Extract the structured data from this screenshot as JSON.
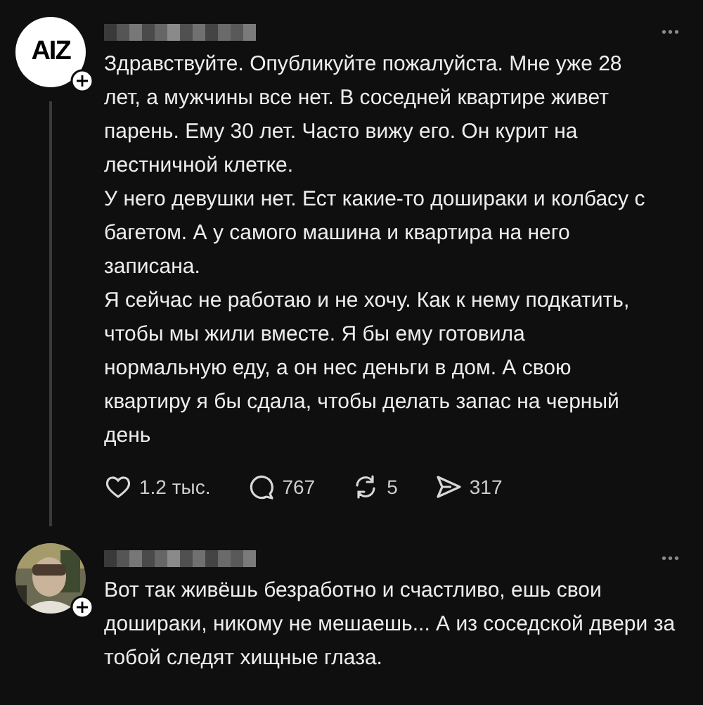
{
  "posts": [
    {
      "avatar": {
        "kind": "logo",
        "text": "AIZ"
      },
      "name_hidden": true,
      "more": "•••",
      "paragraphs": [
        "Здравствуйте. Опубликуйте пожалуйста. Мне уже 28 лет, а мужчины все нет. В соседней квартире живет парень. Ему 30 лет. Часто вижу его. Он курит на лестничной клетке.",
        "У него девушки нет. Ест какие-то дошираки и колбасу с багетом. А у самого машина и квартира на него записана.",
        "Я сейчас не работаю и не хочу. Как к нему подкатить, чтобы мы жили вместе. Я бы ему готовила нормальную еду, а он нес деньги в дом. А свою квартиру я бы сдала, чтобы делать запас на черный день"
      ],
      "actions": [
        {
          "kind": "like",
          "count": "1.2 тыс."
        },
        {
          "kind": "comment",
          "count": "767"
        },
        {
          "kind": "repost",
          "count": "5"
        },
        {
          "kind": "share",
          "count": "317"
        }
      ]
    },
    {
      "avatar": {
        "kind": "picture"
      },
      "name_hidden": true,
      "more": "•••",
      "paragraphs": [
        "Вот так живёшь безработно и счастливо, ешь свои дошираки, никому не мешаешь... А из соседской двери за тобой следят хищные глаза."
      ]
    }
  ]
}
